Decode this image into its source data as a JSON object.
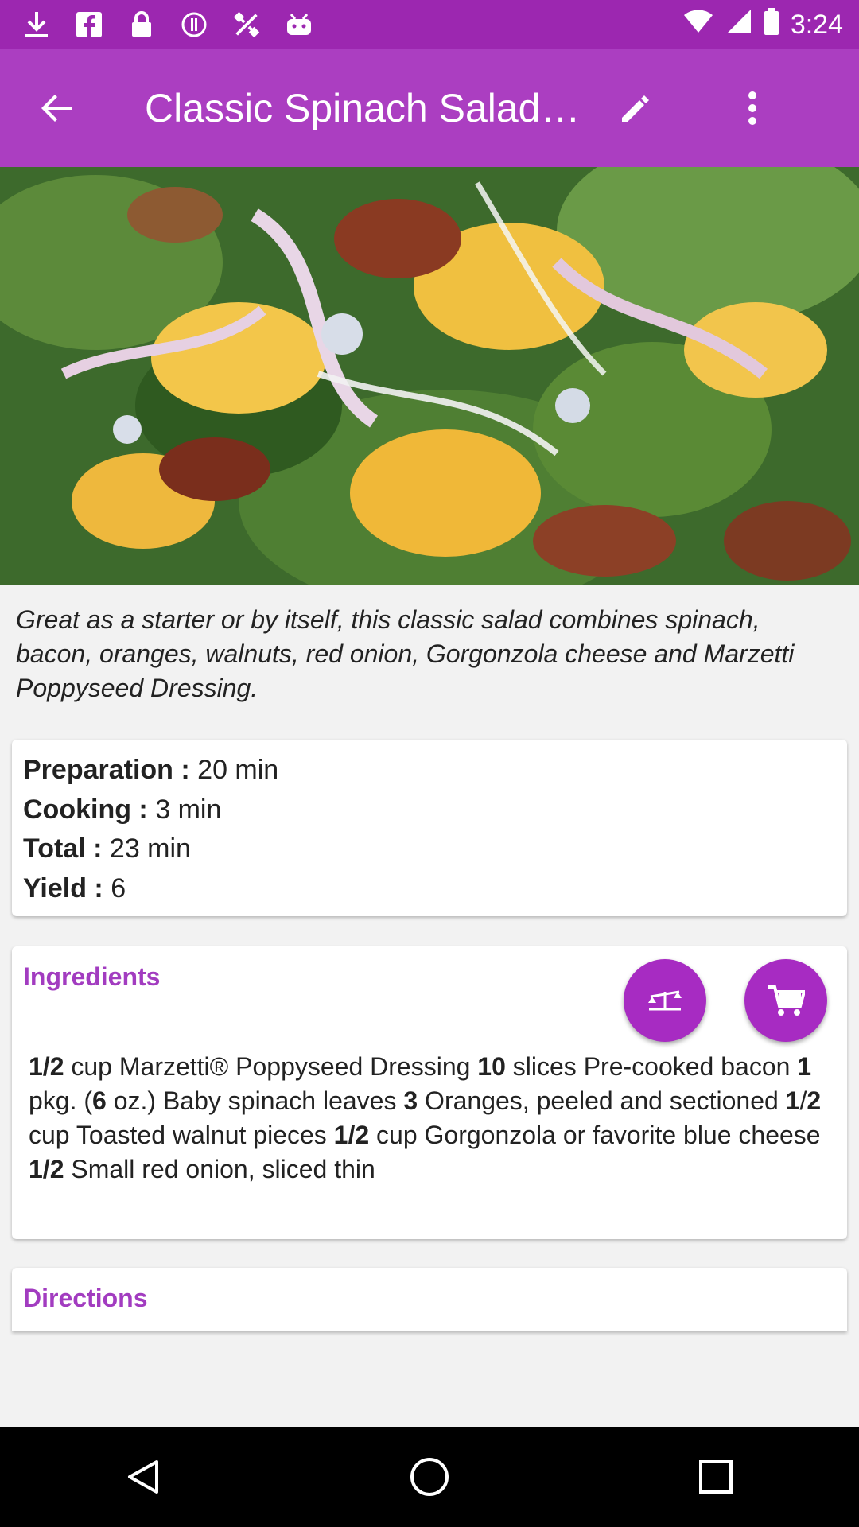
{
  "status_bar": {
    "time": "3:24",
    "icons": [
      "download-icon",
      "facebook-icon",
      "lock-icon",
      "alert-icon",
      "fake-gps-icon",
      "android-icon"
    ]
  },
  "toolbar": {
    "title": "Classic Spinach Salad…",
    "back_icon": "arrow-back-icon",
    "edit_icon": "pencil-icon",
    "more_icon": "more-vert-icon"
  },
  "hero": {
    "alt": "salad photo"
  },
  "description": "Great as a starter or by itself, this classic salad combines spinach, bacon, oranges, walnuts, red onion, Gorgonzola cheese and Marzetti Poppyseed Dressing.",
  "timing": [
    {
      "label": "Preparation :",
      "value": " 20 min"
    },
    {
      "label": "Cooking :",
      "value": " 3 min"
    },
    {
      "label": "Total :",
      "value": " 23 min"
    },
    {
      "label": "Yield :",
      "value": " 6"
    }
  ],
  "ingredients": {
    "title": "Ingredients",
    "scale_icon": "scale-icon",
    "cart_icon": "cart-icon",
    "segments": [
      {
        "t": "1/2",
        "b": true
      },
      {
        "t": " cup Marzetti® Poppyseed Dressing ",
        "b": false
      },
      {
        "t": "10",
        "b": true
      },
      {
        "t": " slices Pre-cooked bacon ",
        "b": false
      },
      {
        "t": "1",
        "b": true
      },
      {
        "t": " pkg. (",
        "b": false
      },
      {
        "t": "6",
        "b": true
      },
      {
        "t": " oz.) Baby spinach leaves ",
        "b": false
      },
      {
        "t": "3",
        "b": true
      },
      {
        "t": " Oranges, peeled and sectioned ",
        "b": false
      },
      {
        "t": "1",
        "b": true
      },
      {
        "t": "/",
        "b": false
      },
      {
        "t": "2",
        "b": true
      },
      {
        "t": " cup Toasted walnut pieces ",
        "b": false
      },
      {
        "t": "1/2",
        "b": true
      },
      {
        "t": " cup Gorgonzola or favorite blue cheese ",
        "b": false
      },
      {
        "t": "1/2",
        "b": true
      },
      {
        "t": " Small red onion, sliced thin",
        "b": false
      }
    ]
  },
  "directions": {
    "title": "Directions"
  },
  "nav": {
    "back": "nav-back-icon",
    "home": "nav-home-icon",
    "recents": "nav-recents-icon"
  }
}
